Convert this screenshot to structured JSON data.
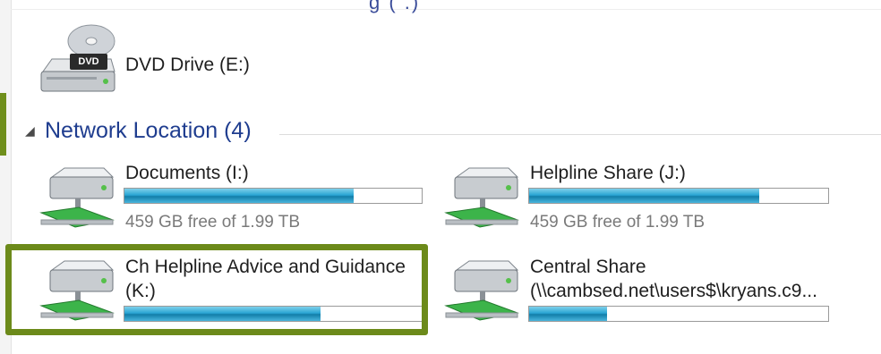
{
  "top_fragment": "g  ( .)",
  "dvd": {
    "label": "DVD Drive (E:)",
    "icon": "dvd-drive-icon",
    "badge": "DVD"
  },
  "group": {
    "caret": "◢",
    "title": "Network Location (4)"
  },
  "drives": [
    {
      "label": "Documents (I:)",
      "sub": "459 GB free of 1.99 TB",
      "fill_fraction": 0.77,
      "icon": "network-drive-icon"
    },
    {
      "label": "Helpline Share (J:)",
      "sub": "459 GB free of 1.99 TB",
      "fill_fraction": 0.77,
      "icon": "network-drive-icon"
    },
    {
      "label": "Ch Helpline Advice and Guidance",
      "label2": "(K:)",
      "fill_fraction": 0.66,
      "icon": "network-drive-icon"
    },
    {
      "label": "Central Share",
      "label2": "(\\\\cambsed.net\\users$\\kryans.c9...",
      "fill_fraction": 0.26,
      "icon": "network-drive-icon"
    }
  ],
  "colors": {
    "accent_border": "#6c8a1a",
    "group_title": "#1f3d8f",
    "bar_fill": "#2aa6d4"
  }
}
